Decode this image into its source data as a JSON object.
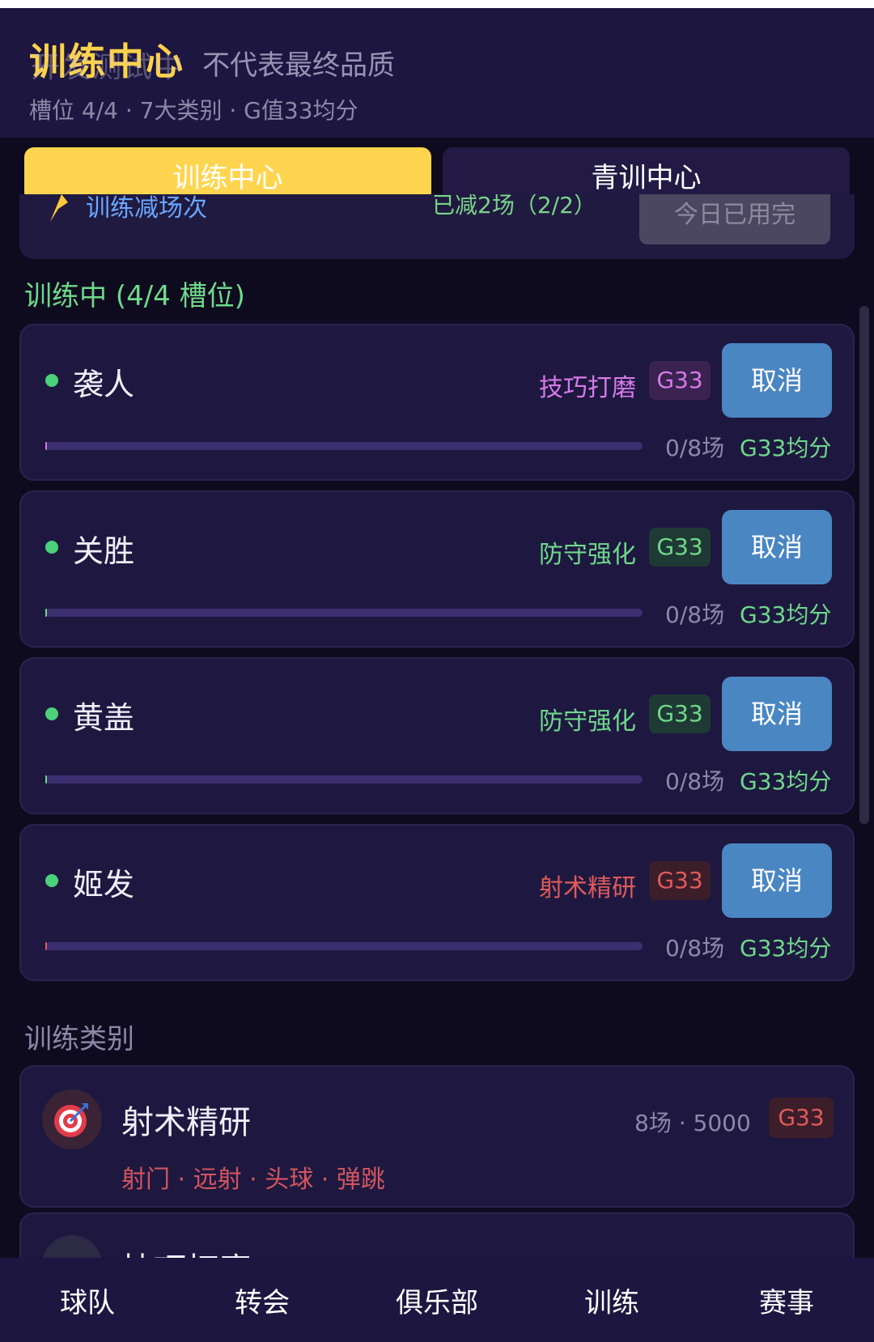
{
  "header": {
    "title": "训练中心",
    "watermark": "开发测试中",
    "subtitle": "不代表最终品质",
    "meta": "槽位 4/4 · 7大类别 · G值33均分"
  },
  "tabs": [
    {
      "label": "训练中心",
      "active": true
    },
    {
      "label": "青训中心",
      "active": false
    }
  ],
  "partial_card": {
    "left_text": "训练减场次",
    "mid_text": "已减2场（2/2）",
    "button": "今日已用完"
  },
  "training_section": {
    "title": "训练中 (4/4 槽位)"
  },
  "slots": [
    {
      "name": "袭人",
      "category": "技巧打磨",
      "category_color": "#d77ae8",
      "badge": "G33",
      "badge_bg": "#3a2350",
      "badge_color": "#d77ae8",
      "cancel": "取消",
      "progress": 0,
      "count": "0/8场",
      "avg": "G33均分"
    },
    {
      "name": "关胜",
      "category": "防守强化",
      "category_color": "#6fd98a",
      "badge": "G33",
      "badge_bg": "#1f3a34",
      "badge_color": "#6fd98a",
      "cancel": "取消",
      "progress": 0,
      "count": "0/8场",
      "avg": "G33均分"
    },
    {
      "name": "黄盖",
      "category": "防守强化",
      "category_color": "#6fd98a",
      "badge": "G33",
      "badge_bg": "#1f3a34",
      "badge_color": "#6fd98a",
      "cancel": "取消",
      "progress": 0,
      "count": "0/8场",
      "avg": "G33均分"
    },
    {
      "name": "姬发",
      "category": "射术精研",
      "category_color": "#e05a5a",
      "badge": "G33",
      "badge_bg": "#3b1e2a",
      "badge_color": "#e05a5a",
      "cancel": "取消",
      "progress": 0,
      "count": "0/8场",
      "avg": "G33均分"
    }
  ],
  "categories_section": {
    "title": "训练类别"
  },
  "categories": [
    {
      "name": "射术精研",
      "icon": "target-icon",
      "meta": "8场 · 5000",
      "badge": "G33",
      "skills": "射门 · 远射 · 头球 · 弹跳"
    },
    {
      "name": "技巧打磨",
      "icon": "soccer-ball-icon"
    }
  ],
  "bottom_nav": [
    "球队",
    "转会",
    "俱乐部",
    "训练",
    "赛事"
  ]
}
